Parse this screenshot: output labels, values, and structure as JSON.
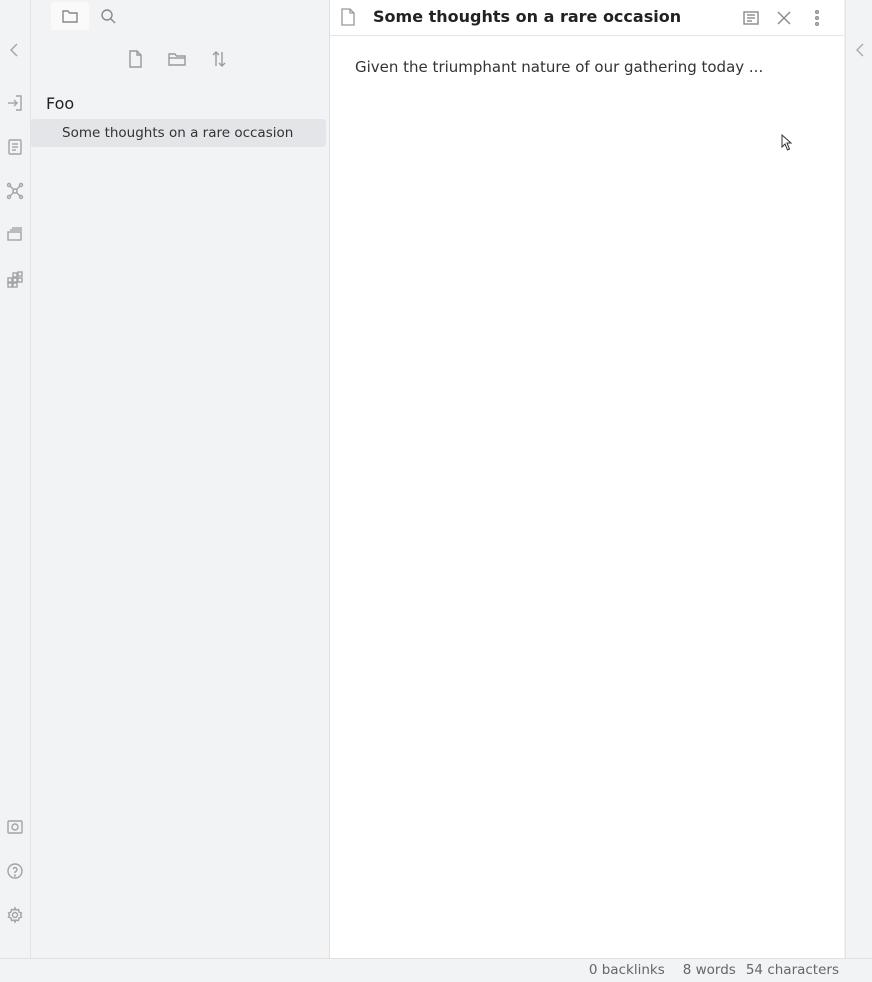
{
  "window": {
    "title": "Some thoughts on a rare occasion"
  },
  "sidebar": {
    "tabs": [
      {
        "name": "file-explorer",
        "icon": "folder-icon",
        "active": true
      },
      {
        "name": "search",
        "icon": "search-icon",
        "active": false
      }
    ],
    "actions": [
      {
        "name": "new-note",
        "icon": "file-icon"
      },
      {
        "name": "new-folder",
        "icon": "folder-icon"
      },
      {
        "name": "sort",
        "icon": "sort-icon"
      }
    ],
    "folder": "Foo",
    "files": [
      {
        "label": "Some thoughts on a rare occasion",
        "selected": true
      }
    ]
  },
  "ribbon": {
    "top_icons": [
      "collapse-left-icon",
      "open-quick-switcher-icon",
      "templates-icon",
      "graph-view-icon",
      "slides-icon",
      "plugins-icon"
    ],
    "bottom_icons": [
      "vault-icon",
      "help-icon",
      "settings-icon"
    ]
  },
  "editor": {
    "title": "Some thoughts on a rare occasion",
    "content": "Given the triumphant nature of our gathering today ...",
    "header_buttons": [
      "preview-icon",
      "close-icon",
      "more-options-icon"
    ]
  },
  "statusbar": {
    "backlinks": "0 backlinks",
    "words": "8 words",
    "characters": "54 characters"
  },
  "colors": {
    "background": "#f2f3f5",
    "editor_background": "#ffffff",
    "selected_item": "#e3e5e8"
  }
}
